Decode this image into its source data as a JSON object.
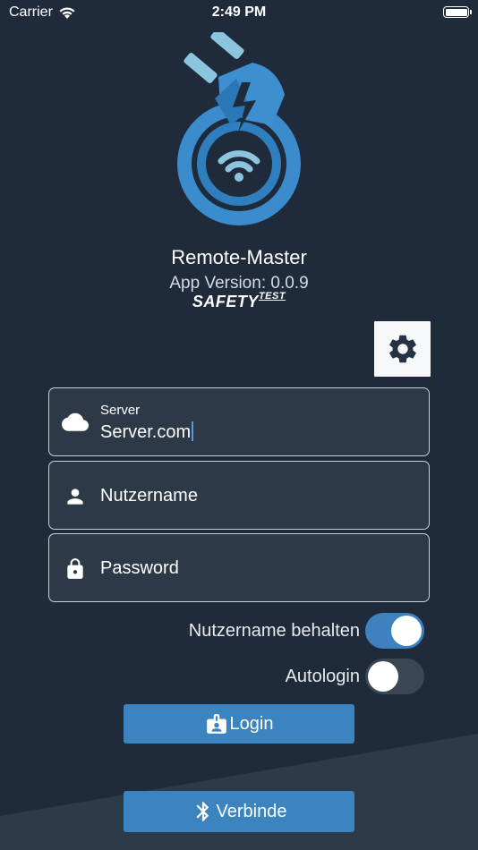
{
  "status_bar": {
    "carrier": "Carrier",
    "time": "2:49 PM"
  },
  "app": {
    "title": "Remote-Master",
    "version": "App Version: 0.0.9",
    "brand_main": "SAFETY",
    "brand_sup": "TEST"
  },
  "form": {
    "server": {
      "caption": "Server",
      "value": "Server.com",
      "icon": "cloud-icon"
    },
    "username": {
      "placeholder": "Nutzername",
      "icon": "person-icon"
    },
    "password": {
      "placeholder": "Password",
      "icon": "lock-icon"
    }
  },
  "toggles": {
    "keep_username": {
      "label": "Nutzername behalten",
      "on": true
    },
    "autologin": {
      "label": "Autologin",
      "on": false
    }
  },
  "buttons": {
    "login": {
      "label": "Login",
      "icon": "id-badge-icon"
    },
    "connect": {
      "label": "Verbinde",
      "icon": "bluetooth-icon"
    },
    "settings": {
      "icon": "gear-icon"
    }
  },
  "colors": {
    "background": "#1f2b3a",
    "accent": "#3b84c0",
    "field_background": "#2d3947"
  }
}
